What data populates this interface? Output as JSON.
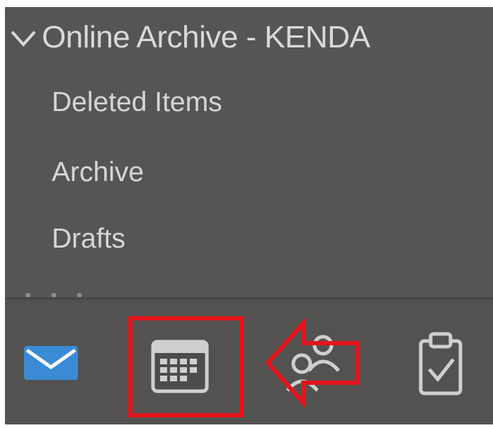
{
  "sidebar": {
    "header": "Online Archive - KENDA",
    "items": [
      {
        "label": "Deleted Items"
      },
      {
        "label": "Archive"
      },
      {
        "label": "Drafts"
      }
    ],
    "more": "• • •"
  },
  "nav_bar": {
    "icons": [
      "mail-icon",
      "calendar-icon",
      "people-icon",
      "tasks-icon"
    ],
    "highlighted": "calendar-icon"
  },
  "colors": {
    "panel_background": "#575554",
    "text": "#d6d6d6",
    "highlight": "#e5141b",
    "mail_accent": "#3a8ad6"
  }
}
